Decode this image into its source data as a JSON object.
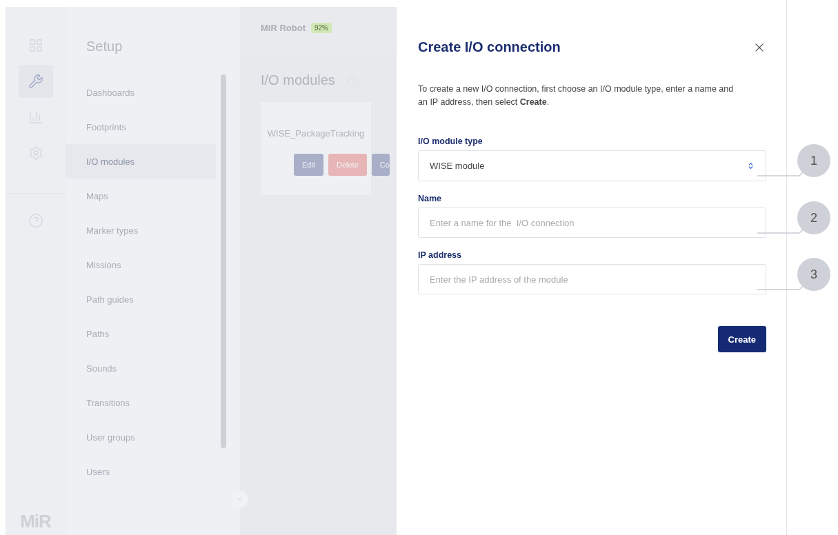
{
  "rail": {
    "items": [
      {
        "kind": "dashboard",
        "selected": false
      },
      {
        "kind": "setup",
        "selected": true
      },
      {
        "kind": "analytics",
        "selected": false
      },
      {
        "kind": "settings",
        "selected": false
      }
    ],
    "logo": "MiR"
  },
  "sidebar": {
    "title": "Setup",
    "items": [
      {
        "label": "Dashboards",
        "selected": false
      },
      {
        "label": "Footprints",
        "selected": false
      },
      {
        "label": "I/O modules",
        "selected": true
      },
      {
        "label": "Maps",
        "selected": false
      },
      {
        "label": "Marker types",
        "selected": false
      },
      {
        "label": "Missions",
        "selected": false
      },
      {
        "label": "Path guides",
        "selected": false
      },
      {
        "label": "Paths",
        "selected": false
      },
      {
        "label": "Sounds",
        "selected": false
      },
      {
        "label": "Transitions",
        "selected": false
      },
      {
        "label": "User groups",
        "selected": false
      },
      {
        "label": "Users",
        "selected": false
      }
    ]
  },
  "topbar": {
    "robot_name": "MiR Robot",
    "battery": "92%"
  },
  "page": {
    "title": "I/O modules",
    "cards": [
      {
        "name": "WISE_PackageTracking",
        "buttons": [
          {
            "label": "Edit",
            "kind": "edit"
          },
          {
            "label": "Delete",
            "kind": "delete"
          },
          {
            "label": "Co",
            "kind": "connect"
          }
        ]
      }
    ]
  },
  "dialog": {
    "title": "Create I/O connection",
    "description": "To create a new I/O connection, first choose an I/O module type, enter a name and an IP address, then select **Create**.",
    "fields": [
      {
        "kind": "select",
        "label": "I/O module type",
        "value": "WISE module",
        "callout": "1"
      },
      {
        "kind": "text",
        "label": "Name",
        "placeholder": "Enter a name for the  I/O connection",
        "callout": "2"
      },
      {
        "kind": "text",
        "label": "IP address",
        "placeholder": "Enter the IP address of the module",
        "callout": "3"
      }
    ],
    "button": "Create"
  }
}
